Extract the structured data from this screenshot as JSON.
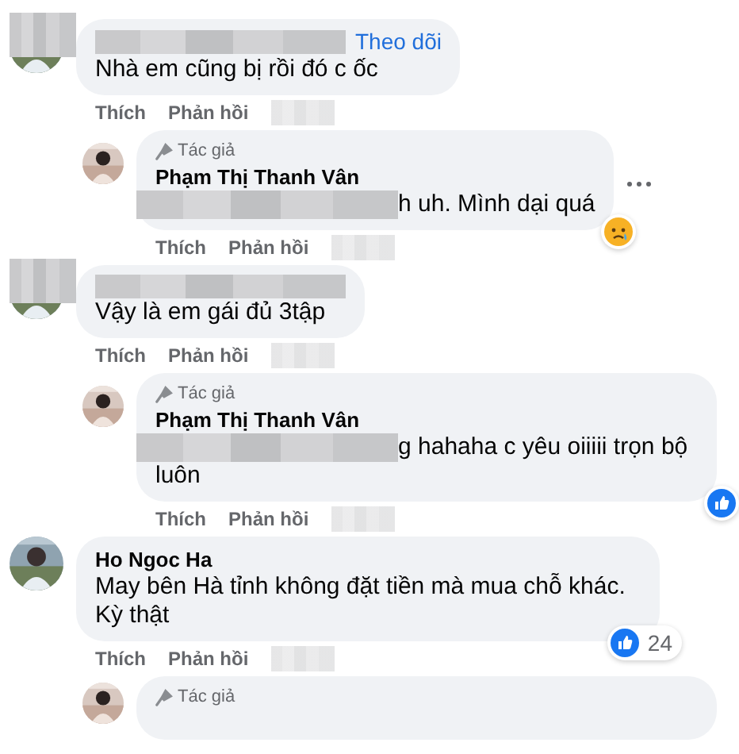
{
  "comments": [
    {
      "kind": "comment",
      "name_blurred": true,
      "follow": "Theo dõi",
      "text": "Nhà em cũng bị rồi đó c ốc",
      "actions": [
        "Thích",
        "Phản hồi"
      ],
      "time_blurred": true
    },
    {
      "kind": "reply",
      "badge": "Tác giả",
      "name": "Phạm Thị Thanh Vân",
      "text_blurred": true,
      "text": "h uh. Mình dại quá",
      "more": true,
      "reaction": {
        "kind": "sad"
      },
      "actions": [
        "Thích",
        "Phản hồi"
      ],
      "time_blurred": true
    },
    {
      "kind": "comment",
      "name_blurred": true,
      "text": "Vậy là em gái đủ 3tập",
      "actions": [
        "Thích",
        "Phản hồi"
      ],
      "time_blurred": true
    },
    {
      "kind": "reply",
      "badge": "Tác giả",
      "name": "Phạm Thị Thanh Vân",
      "text_blurred": true,
      "text": "g hahaha c yêu oiiiii trọn bộ luôn",
      "reaction": {
        "kind": "like"
      },
      "actions": [
        "Thích",
        "Phản hồi"
      ],
      "time_blurred": true
    },
    {
      "kind": "comment",
      "name": "Ho Ngoc Ha",
      "text": "May bên Hà tỉnh không đặt tiền mà mua chỗ khác. Kỳ thật",
      "reaction": {
        "kind": "like",
        "count": "24"
      },
      "actions": [
        "Thích",
        "Phản hồi"
      ],
      "time_blurred": true
    },
    {
      "kind": "reply",
      "badge": "Tác giả"
    }
  ]
}
